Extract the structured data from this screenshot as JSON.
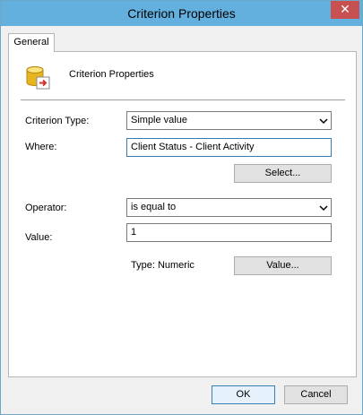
{
  "window": {
    "title": "Criterion Properties",
    "close_glyph": "✕"
  },
  "tabs": [
    {
      "label": "General",
      "active": true
    }
  ],
  "header": {
    "icon": "database-arrow-icon",
    "label": "Criterion Properties"
  },
  "form": {
    "criterion_type": {
      "label": "Criterion Type:",
      "value": "Simple value"
    },
    "where": {
      "label": "Where:",
      "value": "Client Status - Client Activity"
    },
    "select_button": "Select...",
    "operator": {
      "label": "Operator:",
      "value": "is equal to"
    },
    "value": {
      "label": "Value:",
      "value": "1"
    },
    "type_text": "Type: Numeric",
    "value_button": "Value..."
  },
  "footer": {
    "ok_label": "OK",
    "cancel_label": "Cancel"
  },
  "colors": {
    "titlebar": "#63b0de",
    "close": "#c75050",
    "focus_border": "#3d7bad"
  }
}
